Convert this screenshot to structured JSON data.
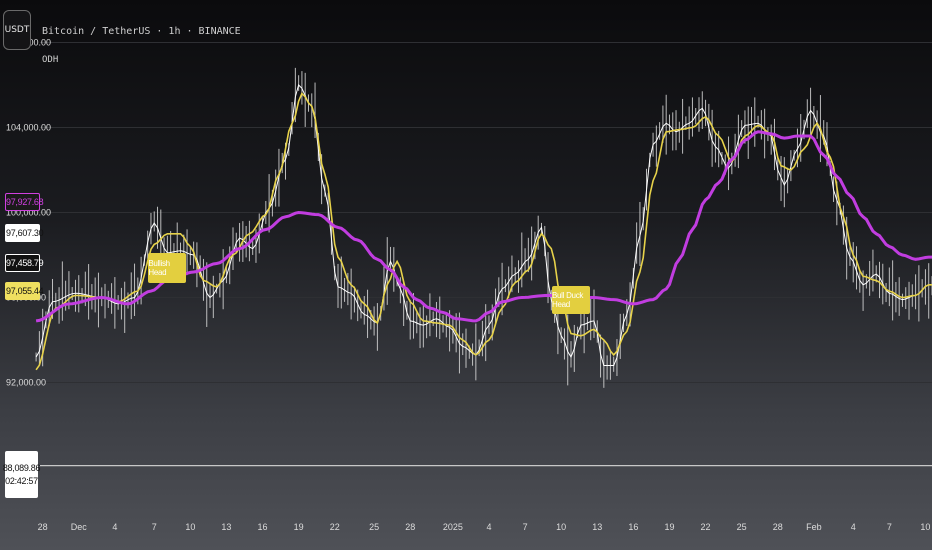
{
  "header": {
    "symbol_button": "USDT",
    "title": "Bitcoin / TetherUS · 1h · BINANCE",
    "subtitle": "ODH"
  },
  "price_tags": [
    {
      "label": "97,927.68",
      "value": 97927.68,
      "bg": "#1a1a1a",
      "fg": "#d040e0",
      "border": "#d040e0"
    },
    {
      "label": "97,607.30",
      "value": 97607.3,
      "bg": "#ffffff",
      "fg": "#111111",
      "border": "#ffffff"
    },
    {
      "label": "97,458.79",
      "value": 97458.79,
      "bg": "#111111",
      "fg": "#ffffff",
      "border": "#ffffff"
    },
    {
      "label": "97,055.44",
      "value": 97055.44,
      "bg": "#f0e060",
      "fg": "#111111",
      "border": "#f0e060"
    }
  ],
  "last_price": {
    "price": "88,089.86",
    "countdown": "02:42:57"
  },
  "labels": [
    {
      "text": "Bullish Head",
      "x_index": 40,
      "y_value": 97400
    },
    {
      "text": "Bull Duck Head",
      "x_index": 163,
      "y_value": 95900
    }
  ],
  "colors": {
    "price": "#ffffff",
    "fast_ma": "#e7d24a",
    "slow_ma": "#c13de0",
    "grid": "#2e2f33",
    "axis_text": "#dcdcdc",
    "label_bg": "#e3cf3f"
  },
  "chart_data": {
    "type": "line",
    "title": "Bitcoin / TetherUS · 1h · BINANCE",
    "ylim": [
      86000,
      110000
    ],
    "y_ticks": [
      92000,
      96000,
      100000,
      104000,
      108000
    ],
    "y_tick_labels": [
      "92,000.00",
      "96,000.00",
      "100,000.00",
      "104,000.00",
      "108,000.00"
    ],
    "x_ticks": [
      {
        "i": 2,
        "label": "28"
      },
      {
        "i": 13,
        "label": "Dec"
      },
      {
        "i": 24,
        "label": "4"
      },
      {
        "i": 36,
        "label": "7"
      },
      {
        "i": 47,
        "label": "10"
      },
      {
        "i": 58,
        "label": "13"
      },
      {
        "i": 69,
        "label": "16"
      },
      {
        "i": 80,
        "label": "19"
      },
      {
        "i": 91,
        "label": "22"
      },
      {
        "i": 103,
        "label": "25"
      },
      {
        "i": 114,
        "label": "28"
      },
      {
        "i": 127,
        "label": "2025"
      },
      {
        "i": 138,
        "label": "4"
      },
      {
        "i": 149,
        "label": "7"
      },
      {
        "i": 160,
        "label": "10"
      },
      {
        "i": 171,
        "label": "13"
      },
      {
        "i": 182,
        "label": "16"
      },
      {
        "i": 193,
        "label": "19"
      },
      {
        "i": 204,
        "label": "22"
      },
      {
        "i": 215,
        "label": "25"
      },
      {
        "i": 226,
        "label": "28"
      },
      {
        "i": 237,
        "label": "Feb"
      },
      {
        "i": 249,
        "label": "4"
      },
      {
        "i": 260,
        "label": "7"
      },
      {
        "i": 271,
        "label": "10"
      }
    ],
    "x_range": [
      -11,
      273
    ],
    "last_price_line": 88089.86,
    "series": [
      {
        "name": "Price",
        "anchors": [
          [
            0,
            93200
          ],
          [
            5,
            95800
          ],
          [
            12,
            96200
          ],
          [
            20,
            96000
          ],
          [
            25,
            95700
          ],
          [
            30,
            96000
          ],
          [
            36,
            99500
          ],
          [
            40,
            98100
          ],
          [
            44,
            98200
          ],
          [
            48,
            98000
          ],
          [
            53,
            96000
          ],
          [
            57,
            96800
          ],
          [
            62,
            98800
          ],
          [
            66,
            98300
          ],
          [
            71,
            100200
          ],
          [
            76,
            102500
          ],
          [
            80,
            106000
          ],
          [
            84,
            105000
          ],
          [
            88,
            101000
          ],
          [
            92,
            96500
          ],
          [
            96,
            96200
          ],
          [
            100,
            95200
          ],
          [
            104,
            94800
          ],
          [
            108,
            97700
          ],
          [
            111,
            96400
          ],
          [
            114,
            94900
          ],
          [
            118,
            94700
          ],
          [
            122,
            95000
          ],
          [
            126,
            94600
          ],
          [
            130,
            93700
          ],
          [
            134,
            93300
          ],
          [
            138,
            94700
          ],
          [
            142,
            96400
          ],
          [
            146,
            97100
          ],
          [
            150,
            97800
          ],
          [
            154,
            99300
          ],
          [
            157,
            95900
          ],
          [
            160,
            94200
          ],
          [
            163,
            93200
          ],
          [
            166,
            94700
          ],
          [
            170,
            94900
          ],
          [
            173,
            92800
          ],
          [
            176,
            92800
          ],
          [
            180,
            95200
          ],
          [
            184,
            98900
          ],
          [
            188,
            103200
          ],
          [
            192,
            104200
          ],
          [
            195,
            103800
          ],
          [
            199,
            104200
          ],
          [
            203,
            104900
          ],
          [
            207,
            103100
          ],
          [
            211,
            102100
          ],
          [
            216,
            104100
          ],
          [
            220,
            104200
          ],
          [
            224,
            103600
          ],
          [
            226,
            102000
          ],
          [
            228,
            101300
          ],
          [
            232,
            103000
          ],
          [
            236,
            104800
          ],
          [
            240,
            103600
          ],
          [
            244,
            100600
          ],
          [
            248,
            97900
          ],
          [
            252,
            96600
          ],
          [
            256,
            97100
          ],
          [
            260,
            96200
          ],
          [
            264,
            95900
          ],
          [
            268,
            96100
          ],
          [
            272,
            96600
          ]
        ]
      },
      {
        "name": "Fast MA",
        "anchors": [
          [
            0,
            92600
          ],
          [
            6,
            95500
          ],
          [
            12,
            96100
          ],
          [
            20,
            96000
          ],
          [
            25,
            95800
          ],
          [
            31,
            96300
          ],
          [
            36,
            98500
          ],
          [
            40,
            99000
          ],
          [
            44,
            99000
          ],
          [
            47,
            98400
          ],
          [
            51,
            96800
          ],
          [
            55,
            96500
          ],
          [
            60,
            98000
          ],
          [
            65,
            99000
          ],
          [
            70,
            99900
          ],
          [
            74,
            101800
          ],
          [
            78,
            104200
          ],
          [
            81,
            105600
          ],
          [
            84,
            105000
          ],
          [
            88,
            101800
          ],
          [
            92,
            97900
          ],
          [
            96,
            96600
          ],
          [
            100,
            95700
          ],
          [
            104,
            94800
          ],
          [
            107,
            96600
          ],
          [
            110,
            97700
          ],
          [
            114,
            95800
          ],
          [
            118,
            94900
          ],
          [
            122,
            94800
          ],
          [
            126,
            94700
          ],
          [
            130,
            94000
          ],
          [
            134,
            93300
          ],
          [
            138,
            94000
          ],
          [
            142,
            95500
          ],
          [
            146,
            96700
          ],
          [
            150,
            97300
          ],
          [
            154,
            99000
          ],
          [
            157,
            98300
          ],
          [
            160,
            96000
          ],
          [
            163,
            94300
          ],
          [
            166,
            94200
          ],
          [
            170,
            94500
          ],
          [
            173,
            94000
          ],
          [
            176,
            93300
          ],
          [
            180,
            94400
          ],
          [
            184,
            97200
          ],
          [
            188,
            101500
          ],
          [
            192,
            103800
          ],
          [
            196,
            103900
          ],
          [
            200,
            104000
          ],
          [
            204,
            104500
          ],
          [
            208,
            103600
          ],
          [
            212,
            102400
          ],
          [
            216,
            103600
          ],
          [
            220,
            104100
          ],
          [
            224,
            103700
          ],
          [
            227,
            102200
          ],
          [
            230,
            102000
          ],
          [
            234,
            103000
          ],
          [
            238,
            104200
          ],
          [
            242,
            102600
          ],
          [
            246,
            99800
          ],
          [
            249,
            98000
          ],
          [
            252,
            97000
          ],
          [
            256,
            96800
          ],
          [
            260,
            96300
          ],
          [
            264,
            96000
          ],
          [
            268,
            96100
          ],
          [
            272,
            96600
          ]
        ]
      },
      {
        "name": "Slow MA",
        "anchors": [
          [
            0,
            94900
          ],
          [
            10,
            95700
          ],
          [
            20,
            96000
          ],
          [
            28,
            95700
          ],
          [
            35,
            96300
          ],
          [
            40,
            96800
          ],
          [
            48,
            97200
          ],
          [
            55,
            97600
          ],
          [
            62,
            98300
          ],
          [
            70,
            99200
          ],
          [
            76,
            99800
          ],
          [
            80,
            100000
          ],
          [
            86,
            99900
          ],
          [
            92,
            99300
          ],
          [
            98,
            98700
          ],
          [
            104,
            97800
          ],
          [
            108,
            97300
          ],
          [
            112,
            96500
          ],
          [
            116,
            95900
          ],
          [
            120,
            95500
          ],
          [
            124,
            95300
          ],
          [
            128,
            95000
          ],
          [
            134,
            94900
          ],
          [
            138,
            95300
          ],
          [
            142,
            95800
          ],
          [
            148,
            96000
          ],
          [
            156,
            96100
          ],
          [
            164,
            96000
          ],
          [
            170,
            96000
          ],
          [
            176,
            95900
          ],
          [
            182,
            95700
          ],
          [
            188,
            95900
          ],
          [
            192,
            96400
          ],
          [
            196,
            97800
          ],
          [
            200,
            99200
          ],
          [
            204,
            100600
          ],
          [
            208,
            101400
          ],
          [
            212,
            102500
          ],
          [
            216,
            103400
          ],
          [
            220,
            103800
          ],
          [
            224,
            103700
          ],
          [
            228,
            103500
          ],
          [
            232,
            103600
          ],
          [
            236,
            103600
          ],
          [
            240,
            102700
          ],
          [
            244,
            101700
          ],
          [
            248,
            100800
          ],
          [
            252,
            99800
          ],
          [
            256,
            99000
          ],
          [
            260,
            98400
          ],
          [
            264,
            98000
          ],
          [
            268,
            97800
          ],
          [
            272,
            97900
          ]
        ]
      }
    ]
  }
}
